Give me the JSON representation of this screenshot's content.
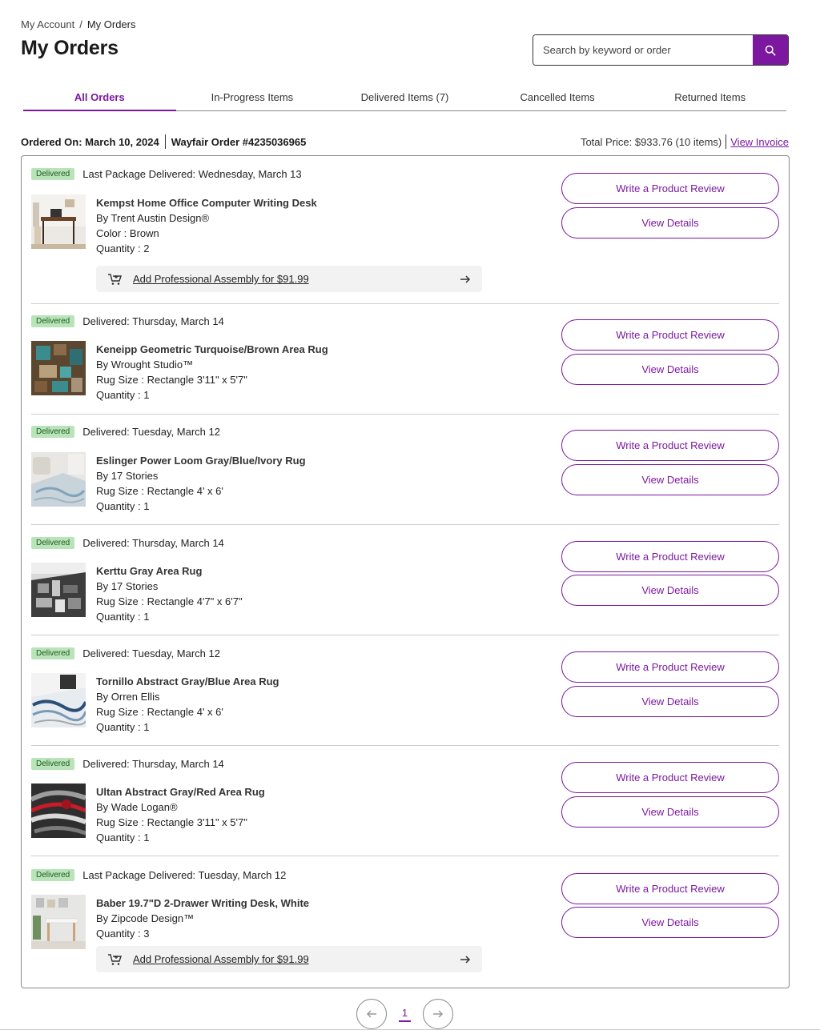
{
  "breadcrumb": {
    "parent": "My Account",
    "separator": "/",
    "current": "My Orders"
  },
  "page_title": "My Orders",
  "search": {
    "placeholder": "Search by keyword or order",
    "icon": "search-icon"
  },
  "tabs": [
    {
      "label": "All Orders",
      "active": true
    },
    {
      "label": "In-Progress Items",
      "active": false
    },
    {
      "label": "Delivered Items (7)",
      "active": false
    },
    {
      "label": "Cancelled Items",
      "active": false
    },
    {
      "label": "Returned Items",
      "active": false
    }
  ],
  "order": {
    "ordered_on": "Ordered On: March 10, 2024",
    "order_number": "Wayfair Order #4235036965",
    "total_price": "Total Price: $933.76 (10 items)",
    "view_invoice": "View Invoice"
  },
  "buttons": {
    "review": "Write a Product Review",
    "details": "View Details"
  },
  "items": [
    {
      "badge": "Delivered",
      "status": "Last Package Delivered: Wednesday, March 13",
      "name": "Kempst Home Office Computer Writing Desk",
      "brand": "By Trent Austin Design®",
      "attr": "Color : Brown",
      "quantity": "Quantity : 2",
      "assembly": "Add Professional Assembly for $91.99",
      "thumb": "desk-brown"
    },
    {
      "badge": "Delivered",
      "status": "Delivered: Thursday, March 14",
      "name": "Keneipp Geometric Turquoise/Brown Area Rug",
      "brand": "By Wrought Studio™",
      "attr": "Rug Size : Rectangle 3'11\" x 5'7\"",
      "quantity": "Quantity : 1",
      "thumb": "rug-turquoise"
    },
    {
      "badge": "Delivered",
      "status": "Delivered: Tuesday, March 12",
      "name": "Eslinger Power Loom Gray/Blue/Ivory Rug",
      "brand": "By 17 Stories",
      "attr": "Rug Size : Rectangle 4' x 6'",
      "quantity": "Quantity : 1",
      "thumb": "rug-ivory"
    },
    {
      "badge": "Delivered",
      "status": "Delivered: Thursday, March 14",
      "name": "Kerttu Gray Area Rug",
      "brand": "By 17 Stories",
      "attr": "Rug Size : Rectangle 4'7\" x 6'7\"",
      "quantity": "Quantity : 1",
      "thumb": "rug-gray"
    },
    {
      "badge": "Delivered",
      "status": "Delivered: Tuesday, March 12",
      "name": "Tornillo Abstract Gray/Blue Area Rug",
      "brand": "By Orren Ellis",
      "attr": "Rug Size : Rectangle 4' x 6'",
      "quantity": "Quantity : 1",
      "thumb": "rug-wave"
    },
    {
      "badge": "Delivered",
      "status": "Delivered: Thursday, March 14",
      "name": "Ultan Abstract Gray/Red Area Rug",
      "brand": "By Wade Logan®",
      "attr": "Rug Size : Rectangle 3'11\" x 5'7\"",
      "quantity": "Quantity : 1",
      "thumb": "rug-red"
    },
    {
      "badge": "Delivered",
      "status": "Last Package Delivered: Tuesday, March 12",
      "name": "Baber 19.7\"D 2-Drawer Writing Desk, White",
      "brand": "By Zipcode Design™",
      "quantity": "Quantity : 3",
      "assembly": "Add Professional Assembly for $91.99",
      "thumb": "desk-white"
    }
  ],
  "pagination": {
    "current_page": "1"
  },
  "colors": {
    "accent": "#7b189f",
    "badge_bg": "#b9e3b9",
    "badge_text": "#1f5a1f"
  }
}
